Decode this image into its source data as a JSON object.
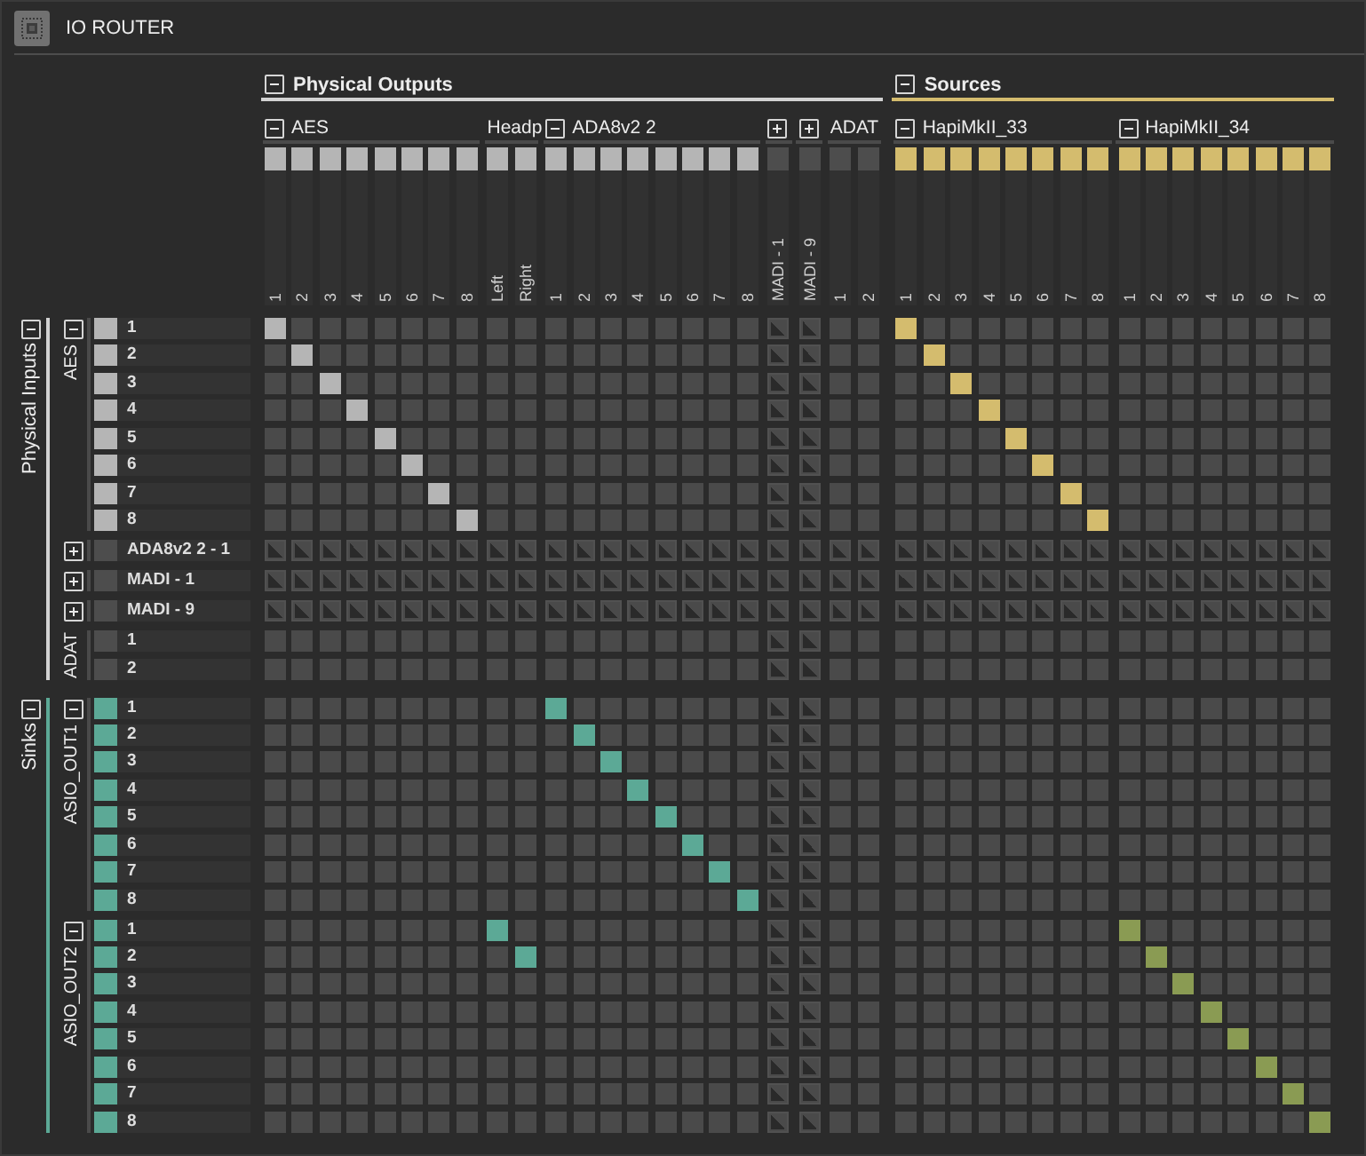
{
  "window": {
    "title": "IO ROUTER"
  },
  "columns": {
    "sections": [
      {
        "title": "Physical Outputs",
        "kind": "outputs",
        "expanded": true,
        "color": "#d2d2d2",
        "groups": [
          {
            "name": "AES",
            "expanded": true,
            "color": "#b5b5b5",
            "channels": [
              "1",
              "2",
              "3",
              "4",
              "5",
              "6",
              "7",
              "8"
            ]
          },
          {
            "name": "Headp",
            "color": "#b5b5b5",
            "channels": [
              "Left",
              "Right"
            ]
          },
          {
            "name": "ADA8v2 2",
            "expanded": true,
            "color": "#b5b5b5",
            "channels": [
              "1",
              "2",
              "3",
              "4",
              "5",
              "6",
              "7",
              "8"
            ]
          },
          {
            "name": "MADI - 1",
            "expanded": false,
            "color": "#4d4d4d"
          },
          {
            "name": "MADI - 9",
            "expanded": false,
            "color": "#4d4d4d"
          },
          {
            "name": "ADAT",
            "color": "#4d4d4d",
            "channels": [
              "1",
              "2"
            ]
          }
        ]
      },
      {
        "title": "Sources",
        "kind": "sources",
        "expanded": true,
        "color": "#d4bc6e",
        "groups": [
          {
            "name": "HapiMkII_33",
            "expanded": true,
            "color": "#d4bc6e",
            "channels": [
              "1",
              "2",
              "3",
              "4",
              "5",
              "6",
              "7",
              "8"
            ]
          },
          {
            "name": "HapiMkII_34",
            "expanded": true,
            "color": "#d4bc6e",
            "channels": [
              "1",
              "2",
              "3",
              "4",
              "5",
              "6",
              "7",
              "8"
            ]
          }
        ]
      }
    ]
  },
  "rows": {
    "sections": [
      {
        "title": "Physical Inputs",
        "kind": "inputs",
        "expanded": true,
        "color": "#d2d2d2",
        "groups": [
          {
            "name": "AES",
            "expanded": true,
            "color": "#b5b5b5",
            "channels": [
              {
                "label": "1",
                "routes": [
                  true,
                  false,
                  false,
                  false,
                  false,
                  false,
                  false,
                  false,
                  false,
                  false,
                  false,
                  false,
                  false,
                  false,
                  false,
                  false,
                  false,
                  false,
                  false,
                  false,
                  false,
                  false,
                  true,
                  false,
                  false,
                  false,
                  false,
                  false,
                  false,
                  false,
                  false,
                  false,
                  false,
                  false,
                  false,
                  false,
                  false,
                  false
                ]
              },
              {
                "label": "2",
                "routes": [
                  false,
                  true,
                  false,
                  false,
                  false,
                  false,
                  false,
                  false,
                  false,
                  false,
                  false,
                  false,
                  false,
                  false,
                  false,
                  false,
                  false,
                  false,
                  false,
                  false,
                  false,
                  false,
                  false,
                  true,
                  false,
                  false,
                  false,
                  false,
                  false,
                  false,
                  false,
                  false,
                  false,
                  false,
                  false,
                  false,
                  false,
                  false
                ]
              },
              {
                "label": "3",
                "routes": [
                  false,
                  false,
                  true,
                  false,
                  false,
                  false,
                  false,
                  false,
                  false,
                  false,
                  false,
                  false,
                  false,
                  false,
                  false,
                  false,
                  false,
                  false,
                  false,
                  false,
                  false,
                  false,
                  false,
                  false,
                  true,
                  false,
                  false,
                  false,
                  false,
                  false,
                  false,
                  false,
                  false,
                  false,
                  false,
                  false,
                  false,
                  false
                ]
              },
              {
                "label": "4",
                "routes": [
                  false,
                  false,
                  false,
                  true,
                  false,
                  false,
                  false,
                  false,
                  false,
                  false,
                  false,
                  false,
                  false,
                  false,
                  false,
                  false,
                  false,
                  false,
                  false,
                  false,
                  false,
                  false,
                  false,
                  false,
                  false,
                  true,
                  false,
                  false,
                  false,
                  false,
                  false,
                  false,
                  false,
                  false,
                  false,
                  false,
                  false,
                  false
                ]
              },
              {
                "label": "5",
                "routes": [
                  false,
                  false,
                  false,
                  false,
                  true,
                  false,
                  false,
                  false,
                  false,
                  false,
                  false,
                  false,
                  false,
                  false,
                  false,
                  false,
                  false,
                  false,
                  false,
                  false,
                  false,
                  false,
                  false,
                  false,
                  false,
                  false,
                  true,
                  false,
                  false,
                  false,
                  false,
                  false,
                  false,
                  false,
                  false,
                  false,
                  false,
                  false
                ]
              },
              {
                "label": "6",
                "routes": [
                  false,
                  false,
                  false,
                  false,
                  false,
                  true,
                  false,
                  false,
                  false,
                  false,
                  false,
                  false,
                  false,
                  false,
                  false,
                  false,
                  false,
                  false,
                  false,
                  false,
                  false,
                  false,
                  false,
                  false,
                  false,
                  false,
                  false,
                  true,
                  false,
                  false,
                  false,
                  false,
                  false,
                  false,
                  false,
                  false,
                  false,
                  false
                ]
              },
              {
                "label": "7",
                "routes": [
                  false,
                  false,
                  false,
                  false,
                  false,
                  false,
                  true,
                  false,
                  false,
                  false,
                  false,
                  false,
                  false,
                  false,
                  false,
                  false,
                  false,
                  false,
                  false,
                  false,
                  false,
                  false,
                  false,
                  false,
                  false,
                  false,
                  false,
                  false,
                  true,
                  false,
                  false,
                  false,
                  false,
                  false,
                  false,
                  false,
                  false,
                  false
                ]
              },
              {
                "label": "8",
                "routes": [
                  false,
                  false,
                  false,
                  false,
                  false,
                  false,
                  false,
                  true,
                  false,
                  false,
                  false,
                  false,
                  false,
                  false,
                  false,
                  false,
                  false,
                  false,
                  false,
                  false,
                  false,
                  false,
                  false,
                  false,
                  false,
                  false,
                  false,
                  false,
                  false,
                  true,
                  false,
                  false,
                  false,
                  false,
                  false,
                  false,
                  false,
                  false
                ]
              }
            ]
          },
          {
            "name": "ADA8v2 2 - 1",
            "expanded": false,
            "color": "#4d4d4d",
            "routes": [
              false,
              false,
              false,
              false,
              false,
              false,
              false,
              false,
              false,
              false,
              false,
              false,
              false,
              false,
              false,
              false,
              false,
              false,
              false,
              false,
              false,
              false,
              false,
              false,
              false,
              false,
              false,
              false,
              false,
              false,
              false,
              false,
              false,
              false,
              false,
              false,
              false,
              false
            ]
          },
          {
            "name": "MADI - 1",
            "expanded": false,
            "color": "#4d4d4d",
            "routes": [
              false,
              false,
              false,
              false,
              false,
              false,
              false,
              false,
              false,
              false,
              false,
              false,
              false,
              false,
              false,
              false,
              false,
              false,
              false,
              false,
              false,
              false,
              false,
              false,
              false,
              false,
              false,
              false,
              false,
              false,
              false,
              false,
              false,
              false,
              false,
              false,
              false,
              false
            ]
          },
          {
            "name": "MADI - 9",
            "expanded": false,
            "color": "#4d4d4d",
            "routes": [
              false,
              false,
              false,
              false,
              false,
              false,
              false,
              false,
              false,
              false,
              false,
              false,
              false,
              false,
              false,
              false,
              false,
              false,
              false,
              false,
              false,
              false,
              false,
              false,
              false,
              false,
              false,
              false,
              false,
              false,
              false,
              false,
              false,
              false,
              false,
              false,
              false,
              false
            ]
          },
          {
            "name": "ADAT",
            "color": "#4d4d4d",
            "channels": [
              {
                "label": "1",
                "routes": [
                  false,
                  false,
                  false,
                  false,
                  false,
                  false,
                  false,
                  false,
                  false,
                  false,
                  false,
                  false,
                  false,
                  false,
                  false,
                  false,
                  false,
                  false,
                  false,
                  false,
                  false,
                  false,
                  false,
                  false,
                  false,
                  false,
                  false,
                  false,
                  false,
                  false,
                  false,
                  false,
                  false,
                  false,
                  false,
                  false,
                  false,
                  false
                ]
              },
              {
                "label": "2",
                "routes": [
                  false,
                  false,
                  false,
                  false,
                  false,
                  false,
                  false,
                  false,
                  false,
                  false,
                  false,
                  false,
                  false,
                  false,
                  false,
                  false,
                  false,
                  false,
                  false,
                  false,
                  false,
                  false,
                  false,
                  false,
                  false,
                  false,
                  false,
                  false,
                  false,
                  false,
                  false,
                  false,
                  false,
                  false,
                  false,
                  false,
                  false,
                  false
                ]
              }
            ]
          }
        ]
      },
      {
        "title": "Sinks",
        "kind": "sinks",
        "expanded": true,
        "color": "#5ca996",
        "groups": [
          {
            "name": "ASIO_OUT1",
            "expanded": true,
            "color": "#5ca996",
            "channels": [
              {
                "label": "1",
                "routes": [
                  false,
                  false,
                  false,
                  false,
                  false,
                  false,
                  false,
                  false,
                  false,
                  false,
                  true,
                  false,
                  false,
                  false,
                  false,
                  false,
                  false,
                  false,
                  false,
                  false,
                  false,
                  false,
                  false,
                  false,
                  false,
                  false,
                  false,
                  false,
                  false,
                  false,
                  false,
                  false,
                  false,
                  false,
                  false,
                  false,
                  false,
                  false
                ]
              },
              {
                "label": "2",
                "routes": [
                  false,
                  false,
                  false,
                  false,
                  false,
                  false,
                  false,
                  false,
                  false,
                  false,
                  false,
                  true,
                  false,
                  false,
                  false,
                  false,
                  false,
                  false,
                  false,
                  false,
                  false,
                  false,
                  false,
                  false,
                  false,
                  false,
                  false,
                  false,
                  false,
                  false,
                  false,
                  false,
                  false,
                  false,
                  false,
                  false,
                  false,
                  false
                ]
              },
              {
                "label": "3",
                "routes": [
                  false,
                  false,
                  false,
                  false,
                  false,
                  false,
                  false,
                  false,
                  false,
                  false,
                  false,
                  false,
                  true,
                  false,
                  false,
                  false,
                  false,
                  false,
                  false,
                  false,
                  false,
                  false,
                  false,
                  false,
                  false,
                  false,
                  false,
                  false,
                  false,
                  false,
                  false,
                  false,
                  false,
                  false,
                  false,
                  false,
                  false,
                  false
                ]
              },
              {
                "label": "4",
                "routes": [
                  false,
                  false,
                  false,
                  false,
                  false,
                  false,
                  false,
                  false,
                  false,
                  false,
                  false,
                  false,
                  false,
                  true,
                  false,
                  false,
                  false,
                  false,
                  false,
                  false,
                  false,
                  false,
                  false,
                  false,
                  false,
                  false,
                  false,
                  false,
                  false,
                  false,
                  false,
                  false,
                  false,
                  false,
                  false,
                  false,
                  false,
                  false
                ]
              },
              {
                "label": "5",
                "routes": [
                  false,
                  false,
                  false,
                  false,
                  false,
                  false,
                  false,
                  false,
                  false,
                  false,
                  false,
                  false,
                  false,
                  false,
                  true,
                  false,
                  false,
                  false,
                  false,
                  false,
                  false,
                  false,
                  false,
                  false,
                  false,
                  false,
                  false,
                  false,
                  false,
                  false,
                  false,
                  false,
                  false,
                  false,
                  false,
                  false,
                  false,
                  false
                ]
              },
              {
                "label": "6",
                "routes": [
                  false,
                  false,
                  false,
                  false,
                  false,
                  false,
                  false,
                  false,
                  false,
                  false,
                  false,
                  false,
                  false,
                  false,
                  false,
                  true,
                  false,
                  false,
                  false,
                  false,
                  false,
                  false,
                  false,
                  false,
                  false,
                  false,
                  false,
                  false,
                  false,
                  false,
                  false,
                  false,
                  false,
                  false,
                  false,
                  false,
                  false,
                  false
                ]
              },
              {
                "label": "7",
                "routes": [
                  false,
                  false,
                  false,
                  false,
                  false,
                  false,
                  false,
                  false,
                  false,
                  false,
                  false,
                  false,
                  false,
                  false,
                  false,
                  false,
                  true,
                  false,
                  false,
                  false,
                  false,
                  false,
                  false,
                  false,
                  false,
                  false,
                  false,
                  false,
                  false,
                  false,
                  false,
                  false,
                  false,
                  false,
                  false,
                  false,
                  false,
                  false
                ]
              },
              {
                "label": "8",
                "routes": [
                  false,
                  false,
                  false,
                  false,
                  false,
                  false,
                  false,
                  false,
                  false,
                  false,
                  false,
                  false,
                  false,
                  false,
                  false,
                  false,
                  false,
                  true,
                  false,
                  false,
                  false,
                  false,
                  false,
                  false,
                  false,
                  false,
                  false,
                  false,
                  false,
                  false,
                  false,
                  false,
                  false,
                  false,
                  false,
                  false,
                  false,
                  false
                ]
              }
            ]
          },
          {
            "name": "ASIO_OUT2",
            "expanded": true,
            "color": "#5ca996",
            "channels": [
              {
                "label": "1",
                "routes": [
                  false,
                  false,
                  false,
                  false,
                  false,
                  false,
                  false,
                  false,
                  true,
                  false,
                  false,
                  false,
                  false,
                  false,
                  false,
                  false,
                  false,
                  false,
                  false,
                  false,
                  false,
                  false,
                  false,
                  false,
                  false,
                  false,
                  false,
                  false,
                  false,
                  false,
                  true,
                  false,
                  false,
                  false,
                  false,
                  false,
                  false,
                  false
                ]
              },
              {
                "label": "2",
                "routes": [
                  false,
                  false,
                  false,
                  false,
                  false,
                  false,
                  false,
                  false,
                  false,
                  true,
                  false,
                  false,
                  false,
                  false,
                  false,
                  false,
                  false,
                  false,
                  false,
                  false,
                  false,
                  false,
                  false,
                  false,
                  false,
                  false,
                  false,
                  false,
                  false,
                  false,
                  false,
                  true,
                  false,
                  false,
                  false,
                  false,
                  false,
                  false
                ]
              },
              {
                "label": "3",
                "routes": [
                  false,
                  false,
                  false,
                  false,
                  false,
                  false,
                  false,
                  false,
                  false,
                  false,
                  false,
                  false,
                  false,
                  false,
                  false,
                  false,
                  false,
                  false,
                  false,
                  false,
                  false,
                  false,
                  false,
                  false,
                  false,
                  false,
                  false,
                  false,
                  false,
                  false,
                  false,
                  false,
                  true,
                  false,
                  false,
                  false,
                  false,
                  false
                ]
              },
              {
                "label": "4",
                "routes": [
                  false,
                  false,
                  false,
                  false,
                  false,
                  false,
                  false,
                  false,
                  false,
                  false,
                  false,
                  false,
                  false,
                  false,
                  false,
                  false,
                  false,
                  false,
                  false,
                  false,
                  false,
                  false,
                  false,
                  false,
                  false,
                  false,
                  false,
                  false,
                  false,
                  false,
                  false,
                  false,
                  false,
                  true,
                  false,
                  false,
                  false,
                  false
                ]
              },
              {
                "label": "5",
                "routes": [
                  false,
                  false,
                  false,
                  false,
                  false,
                  false,
                  false,
                  false,
                  false,
                  false,
                  false,
                  false,
                  false,
                  false,
                  false,
                  false,
                  false,
                  false,
                  false,
                  false,
                  false,
                  false,
                  false,
                  false,
                  false,
                  false,
                  false,
                  false,
                  false,
                  false,
                  false,
                  false,
                  false,
                  false,
                  true,
                  false,
                  false,
                  false
                ]
              },
              {
                "label": "6",
                "routes": [
                  false,
                  false,
                  false,
                  false,
                  false,
                  false,
                  false,
                  false,
                  false,
                  false,
                  false,
                  false,
                  false,
                  false,
                  false,
                  false,
                  false,
                  false,
                  false,
                  false,
                  false,
                  false,
                  false,
                  false,
                  false,
                  false,
                  false,
                  false,
                  false,
                  false,
                  false,
                  false,
                  false,
                  false,
                  false,
                  true,
                  false,
                  false
                ]
              },
              {
                "label": "7",
                "routes": [
                  false,
                  false,
                  false,
                  false,
                  false,
                  false,
                  false,
                  false,
                  false,
                  false,
                  false,
                  false,
                  false,
                  false,
                  false,
                  false,
                  false,
                  false,
                  false,
                  false,
                  false,
                  false,
                  false,
                  false,
                  false,
                  false,
                  false,
                  false,
                  false,
                  false,
                  false,
                  false,
                  false,
                  false,
                  false,
                  false,
                  true,
                  false
                ]
              },
              {
                "label": "8",
                "routes": [
                  false,
                  false,
                  false,
                  false,
                  false,
                  false,
                  false,
                  false,
                  false,
                  false,
                  false,
                  false,
                  false,
                  false,
                  false,
                  false,
                  false,
                  false,
                  false,
                  false,
                  false,
                  false,
                  false,
                  false,
                  false,
                  false,
                  false,
                  false,
                  false,
                  false,
                  false,
                  false,
                  false,
                  false,
                  false,
                  false,
                  false,
                  true
                ]
              }
            ]
          }
        ]
      }
    ]
  }
}
